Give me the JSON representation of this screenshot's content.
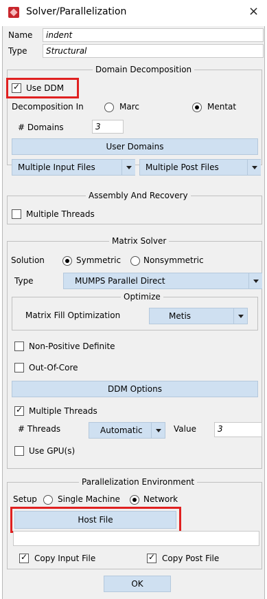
{
  "window": {
    "title": "Solver/Parallelization",
    "close_glyph": "×"
  },
  "header": {
    "name_label": "Name",
    "name_value": "indent",
    "type_label": "Type",
    "type_value": "Structural"
  },
  "domain_decomposition": {
    "legend": "Domain Decomposition",
    "use_ddm_label": "Use DDM",
    "use_ddm_checked": true,
    "decomposition_in_label": "Decomposition In",
    "option_marc": "Marc",
    "option_mentat": "Mentat",
    "selected": "Mentat",
    "domains_label": "# Domains",
    "domains_value": "3",
    "user_domains_button": "User Domains",
    "input_files_select": "Multiple Input Files",
    "post_files_select": "Multiple Post Files"
  },
  "assembly": {
    "legend": "Assembly And Recovery",
    "multiple_threads_label": "Multiple Threads",
    "multiple_threads_checked": false
  },
  "matrix_solver": {
    "legend": "Matrix Solver",
    "solution_label": "Solution",
    "option_symmetric": "Symmetric",
    "option_nonsymmetric": "Nonsymmetric",
    "selected": "Symmetric",
    "type_label": "Type",
    "type_value": "MUMPS Parallel Direct",
    "optimize_legend": "Optimize",
    "fill_opt_label": "Matrix Fill Optimization",
    "fill_opt_value": "Metis",
    "non_positive_label": "Non-Positive Definite",
    "non_positive_checked": false,
    "out_of_core_label": "Out-Of-Core",
    "out_of_core_checked": false,
    "ddm_options_button": "DDM Options",
    "multiple_threads_label": "Multiple Threads",
    "multiple_threads_checked": true,
    "threads_label": "# Threads",
    "threads_mode": "Automatic",
    "value_label": "Value",
    "threads_value": "3",
    "use_gpu_label": "Use GPU(s)",
    "use_gpu_checked": false
  },
  "parallel_env": {
    "legend": "Parallelization Environment",
    "setup_label": "Setup",
    "option_single": "Single Machine",
    "option_network": "Network",
    "selected": "Network",
    "host_file_button": "Host File",
    "host_file_value": "",
    "copy_input_label": "Copy Input File",
    "copy_input_checked": true,
    "copy_post_label": "Copy Post File",
    "copy_post_checked": true
  },
  "ok_button": "OK",
  "colors": {
    "highlight": "#e02020",
    "button_bg": "#cfe0f1",
    "panel_bg": "#f0f0f0"
  }
}
